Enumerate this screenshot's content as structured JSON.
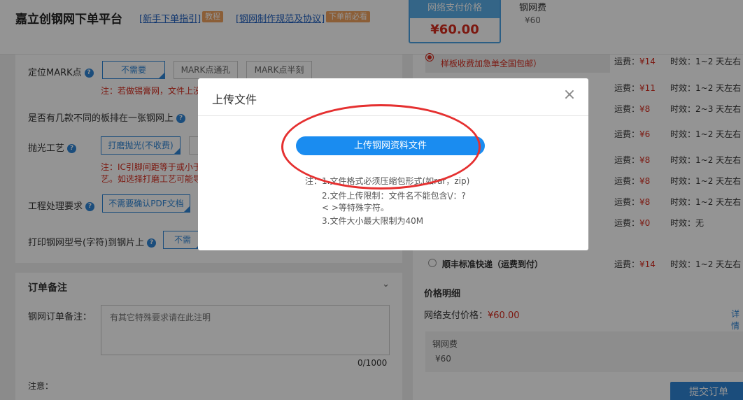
{
  "header": {
    "brand": "嘉立创钢网下单平台",
    "guide_link": "[新手下单指引]",
    "guide_tag": "教程",
    "spec_link": "[钢网制作规范及协议]",
    "spec_tag": "下单前必看",
    "pay_box_title": "网络支付价格",
    "pay_box_amount": "¥60.00",
    "fee_label": "钢网费",
    "fee_value": "¥60"
  },
  "form": {
    "mark_label": "定位MARK点",
    "mark_options": [
      "不需要",
      "MARK点通孔",
      "MARK点半刻"
    ],
    "mark_warning": "注：若做锡膏网，文件上没",
    "multi_board_label": "是否有几款不同的板排在一张钢网上",
    "polish_label": "抛光工艺",
    "polish_option": "打磨抛光(不收费)",
    "polish_warning_1": "注：IC引脚间距等于或小于",
    "polish_warning_2": "艺。如选择打磨工艺可能导",
    "process_label": "工程处理要求",
    "process_option": "不需要确认PDF文档",
    "print_label": "打印钢网型号(字符)到钢片上",
    "print_option": "不需"
  },
  "remark": {
    "title": "订单备注",
    "label": "钢网订单备注：",
    "placeholder": "有其它特殊要求请在此注明",
    "counter": "0/1000",
    "note_label": "注意："
  },
  "shipping": {
    "first_option": "样板收费加急单全国包邮）",
    "fee_prefix": "运费：",
    "eta_prefix": "时效：",
    "rows": [
      {
        "fee": "¥14",
        "eta": "1~2 天左右"
      },
      {
        "fee": "¥11",
        "eta": "1~2 天左右"
      },
      {
        "fee": "¥8",
        "eta": "2~3 天左右"
      },
      {
        "fee": "¥6",
        "eta": "1~2 天左右"
      },
      {
        "fee": "¥8",
        "eta": "1~2 天左右"
      },
      {
        "fee": "¥8",
        "eta": "1~2 天左右"
      },
      {
        "fee": "¥8",
        "eta": "1~2 天左右"
      },
      {
        "fee": "¥0",
        "eta": "无"
      }
    ],
    "sf_name": "顺丰标准快递（运费到付）",
    "sf_fee": "¥14",
    "sf_eta": "1~2 天左右"
  },
  "price": {
    "title": "价格明细",
    "net_label": "网络支付价格：",
    "net_value": "¥60.00",
    "detail_link": "详情",
    "fee_label": "钢网费",
    "fee_value": "¥60",
    "submit": "提交订单"
  },
  "modal": {
    "title": "上传文件",
    "close": "×",
    "upload_button": "上传钢网资料文件",
    "note_1": "注：1.文件格式必须压缩包形式(如rar，zip)",
    "note_2": "2.文件上传限制：文件名不能包含\\/：?",
    "note_3": "< >等特殊字符。",
    "note_4": "3.文件大小最大限制为40M"
  },
  "colors": {
    "accent": "#1a8cf0",
    "price_red": "#d62b1e",
    "annotation": "#e53030"
  }
}
